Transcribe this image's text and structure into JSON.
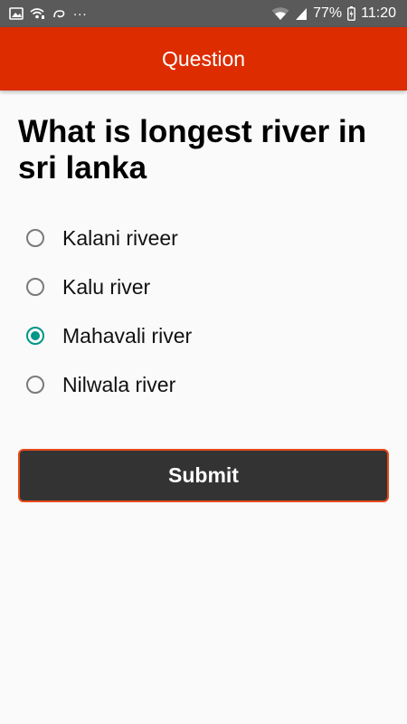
{
  "status_bar": {
    "icons_left": [
      "gallery-icon",
      "wifi-calling-icon",
      "link-icon"
    ],
    "more_indicator": "...",
    "icons_right": [
      "wifi-icon",
      "signal-icon",
      "battery-charging-icon"
    ],
    "battery": "77%",
    "time": "11:20"
  },
  "app_bar": {
    "title": "Question",
    "color": "#dd2c00"
  },
  "question": {
    "text": "What is longest river in sri lanka"
  },
  "options": [
    {
      "label": "Kalani riveer",
      "selected": false
    },
    {
      "label": "Kalu river",
      "selected": false
    },
    {
      "label": "Mahavali river",
      "selected": true
    },
    {
      "label": "Nilwala river",
      "selected": false
    }
  ],
  "submit": {
    "label": "Submit"
  },
  "colors": {
    "accent": "#009688",
    "button_bg": "#333333",
    "button_border": "#e64a19"
  }
}
